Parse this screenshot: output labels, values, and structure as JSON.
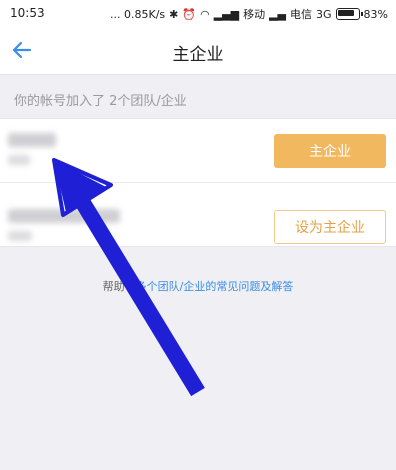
{
  "status_bar": {
    "time": "10:53",
    "network_speed": "... 0.85K/s",
    "carrier1": "移动",
    "carrier2": "电信",
    "network_type": "3G",
    "battery": "83%"
  },
  "nav": {
    "back_icon": "back-arrow-icon",
    "title": "主企业"
  },
  "hint": "你的帐号加入了 2个团队/企业",
  "orgs": [
    {
      "button_label": "主企业"
    },
    {
      "button_label": "设为主企业"
    }
  ],
  "help": {
    "prefix": "帮助中",
    "link_text": "多个团队/企业的常见问题及解答"
  },
  "colors": {
    "accent": "#3a8ee6",
    "primary_button": "#f2b85f",
    "outline_button_text": "#e3a24a",
    "annotation_arrow": "#1f1fd6"
  }
}
